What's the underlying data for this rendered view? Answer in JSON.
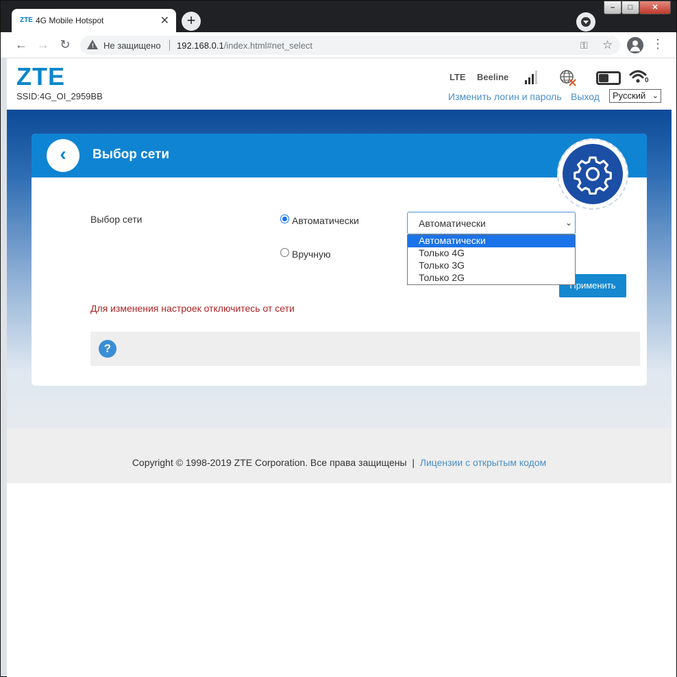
{
  "browser": {
    "tab_favicon": "ZTE",
    "tab_title": "4G Mobile Hotspot",
    "tab_close": "✕",
    "new_tab": "+",
    "security_text": "Не защищено",
    "url_host": "192.168.0.1",
    "url_path": "/index.html#net_select",
    "win_min": "–",
    "win_max": "□",
    "win_close": "✕"
  },
  "header": {
    "logo": "ZTE",
    "ssid": "SSID:4G_OI_2959BB",
    "network_type": "LTE",
    "operator": "Beeline",
    "wifi_clients": "0",
    "change_login_link": "Изменить логин и пароль",
    "logout_link": "Выход",
    "language": "Русский"
  },
  "card": {
    "title": "Выбор сети",
    "field_label": "Выбор сети",
    "radio_auto": "Автоматически",
    "radio_manual": "Вручную",
    "selected_mode": "Автоматически",
    "dropdown_options": [
      "Автоматически",
      "Только 4G",
      "Только 3G",
      "Только 2G"
    ],
    "apply_button": "Применить",
    "warning": "Для изменения настроек отключитесь от сети",
    "help": "?"
  },
  "footer": {
    "copyright": "Copyright © 1998-2019 ZTE Corporation. Все права защищены",
    "separator": "|",
    "license_link": "Лицензии с открытым кодом"
  },
  "colors": {
    "brand": "#0a86cc",
    "card_header": "#0f84d3",
    "gear_badge": "#1b4ea5",
    "warning": "#b22222",
    "link": "#4a8ec8"
  }
}
